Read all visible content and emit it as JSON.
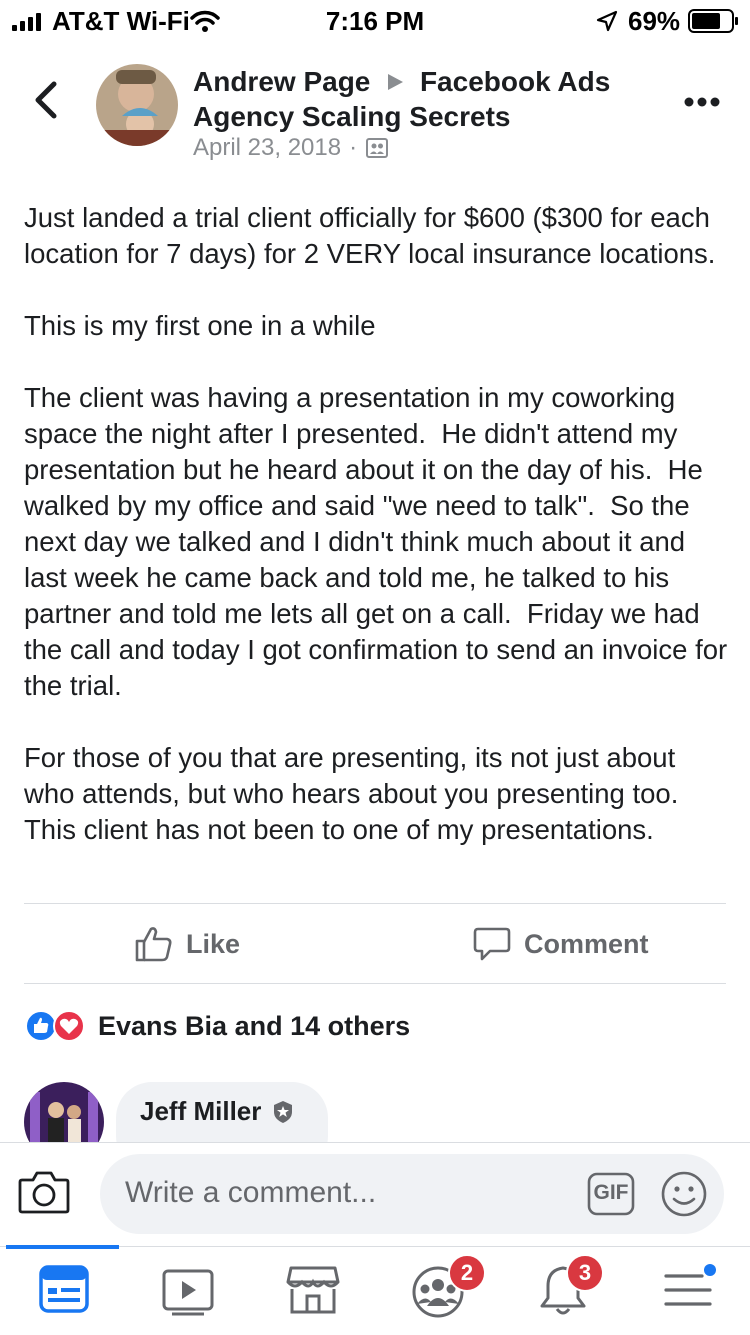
{
  "status_bar": {
    "carrier": "AT&T Wi-Fi",
    "time": "7:16 PM",
    "battery": "69%"
  },
  "post": {
    "author": "Andrew Page",
    "group": "Facebook Ads Agency Scaling Secrets",
    "date": "April 23, 2018",
    "separator": "·",
    "privacy_icon": "group-members-icon",
    "text": "Just landed a trial client officially for $600 ($300 for each location for 7 days) for 2 VERY local insurance locations.\n\nThis is my first one in a while\n\nThe client was having a presentation in my coworking space the night after I presented.  He didn't attend my presentation but he heard about it on the day of his.  He walked by my office and said \"we need to talk\".  So the next day we talked and I didn't think much about it and last week he came back and told me, he talked to his partner and told me lets all get on a call.  Friday we had the call and today I got confirmation to send an invoice for the trial.\n\nFor those of you that are presenting, its not just about who attends, but who hears about you presenting too.  This client has not been to one of my presentations."
  },
  "actions": {
    "like": "Like",
    "comment": "Comment"
  },
  "reactions": {
    "summary": "Evans Bia and 14 others"
  },
  "comment": {
    "author": "Jeff Miller"
  },
  "composer": {
    "placeholder": "Write a comment...",
    "gif": "GIF"
  },
  "tabs": {
    "groups_badge": "2",
    "notifications_badge": "3"
  },
  "colors": {
    "accent": "#1877f2",
    "badge": "#d93840",
    "muted": "#65676b"
  }
}
